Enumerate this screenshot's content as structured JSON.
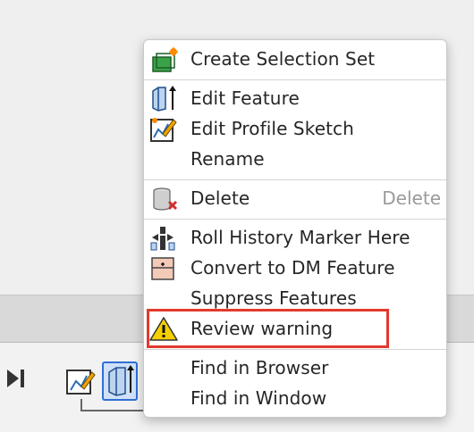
{
  "context_menu": {
    "items": [
      {
        "label": "Create Selection Set",
        "icon": "selection-set-icon",
        "shortcut": ""
      },
      {
        "label": "Edit Feature",
        "icon": "feature-icon",
        "shortcut": ""
      },
      {
        "label": "Edit Profile Sketch",
        "icon": "sketch-icon",
        "shortcut": ""
      },
      {
        "label": "Rename",
        "icon": "",
        "shortcut": ""
      },
      {
        "label": "Delete",
        "icon": "delete-icon",
        "shortcut": "Delete"
      },
      {
        "label": "Roll History Marker Here",
        "icon": "history-marker-icon",
        "shortcut": ""
      },
      {
        "label": "Convert to DM Feature",
        "icon": "dm-feature-icon",
        "shortcut": ""
      },
      {
        "label": "Suppress Features",
        "icon": "",
        "shortcut": ""
      },
      {
        "label": "Review warning",
        "icon": "warning-icon",
        "shortcut": ""
      },
      {
        "label": "Find in Browser",
        "icon": "",
        "shortcut": ""
      },
      {
        "label": "Find in Window",
        "icon": "",
        "shortcut": ""
      }
    ],
    "highlighted_item": "Review warning"
  },
  "timeline": {
    "icons": [
      "timeline-end-icon",
      "sketch-icon",
      "feature-icon"
    ]
  },
  "colors": {
    "highlight_border": "#e23a2e",
    "selected_feature_border": "#2f6fd6",
    "warning_yellow": "#f5d000",
    "delete_red": "#d32f2f"
  }
}
